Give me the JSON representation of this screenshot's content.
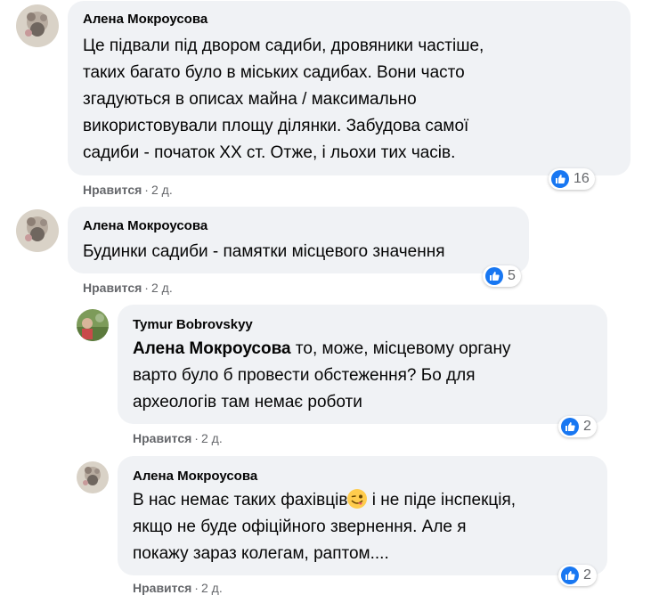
{
  "comments": [
    {
      "author": "Алена Мокроусова",
      "text": "Це підвали під двором садиби, дровяники частіше,\nтаких багато було в міських садибах. Вони часто\nзгадуються в описах майна / максимально\nвикористовували площу ділянки. Забудова самої\nсадиби - початок ХХ ст. Отже, і льохи тих часів.",
      "like_label": "Нравится",
      "time": "2 д.",
      "reaction_count": "16"
    },
    {
      "author": "Алена Мокроусова",
      "text": "Будинки садиби - памятки місцевого значення",
      "like_label": "Нравится",
      "time": "2 д.",
      "reaction_count": "5"
    },
    {
      "author": "Tymur Bobrovskyy",
      "mention": "Алена Мокроусова",
      "text": " то, може, місцевому органу\nварто було б провести обстеження? Бо для\nархеологів там немає роботи",
      "like_label": "Нравится",
      "time": "2 д.",
      "reaction_count": "2"
    },
    {
      "author": "Алена Мокроусова",
      "text_line1_before": "В нас немає таких фахівців",
      "text_line1_after": " і не піде інспекція,",
      "text_rest": "якщо не буде офіційного звернення. Але я\nпокажу зараз колегам, раптом....",
      "like_label": "Нравится",
      "time": "2 д.",
      "reaction_count": "2"
    }
  ],
  "meta_separator": "·",
  "icons": {
    "reaction": "thumbs-up-icon",
    "emoji": "winking-tongue-emoji"
  },
  "colors": {
    "bubble": "#f0f2f5",
    "like_blue": "#1877f2",
    "meta_gray": "#65676b"
  }
}
